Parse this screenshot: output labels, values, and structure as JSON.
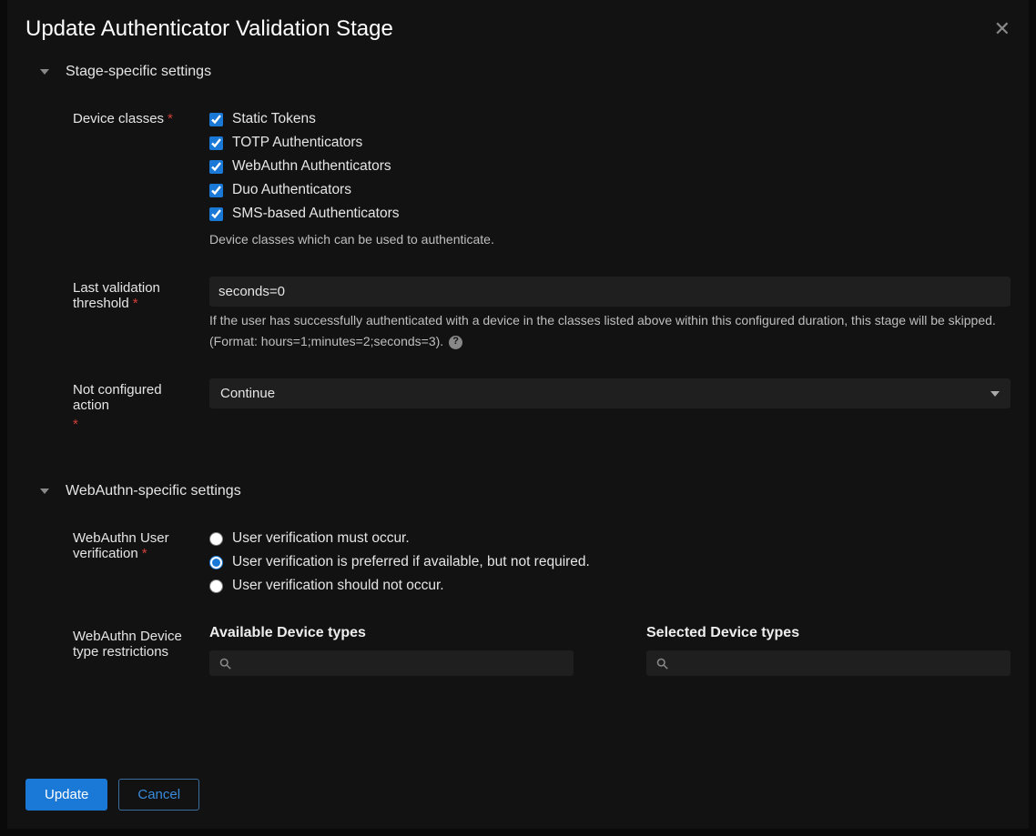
{
  "modal": {
    "title": "Update Authenticator Validation Stage"
  },
  "section1": {
    "title": "Stage-specific settings",
    "device_classes": {
      "label": "Device classes",
      "opt0": "Static Tokens",
      "opt1": "TOTP Authenticators",
      "opt2": "WebAuthn Authenticators",
      "opt3": "Duo Authenticators",
      "opt4": "SMS-based Authenticators",
      "help": "Device classes which can be used to authenticate."
    },
    "last_validation": {
      "label": "Last validation threshold",
      "value": "seconds=0",
      "help": "If the user has successfully authenticated with a device in the classes listed above within this configured duration, this stage will be skipped. (Format: hours=1;minutes=2;seconds=3). "
    },
    "not_configured": {
      "label": "Not configured action",
      "value": "Continue"
    }
  },
  "section2": {
    "title": "WebAuthn-specific settings",
    "user_verification": {
      "label": "WebAuthn User verification",
      "opt0": "User verification must occur.",
      "opt1": "User verification is preferred if available, but not required.",
      "opt2": "User verification should not occur."
    },
    "device_restrictions": {
      "label": "WebAuthn Device type restrictions",
      "available": "Available Device types",
      "selected": "Selected Device types"
    }
  },
  "footer": {
    "update": "Update",
    "cancel": "Cancel"
  }
}
